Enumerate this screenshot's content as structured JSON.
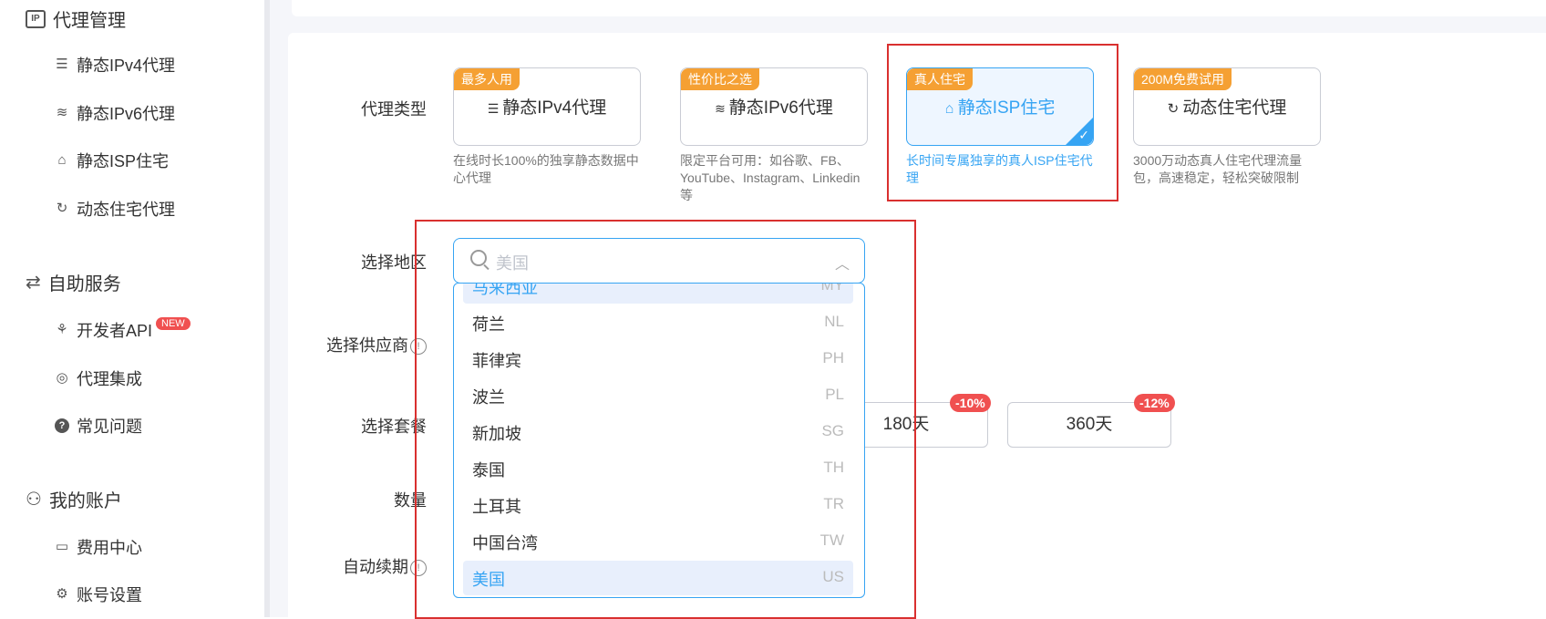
{
  "sidebar": {
    "groups": [
      {
        "label": "代理管理",
        "icon": "ip-icon"
      },
      {
        "label": "自助服务",
        "icon": "self-service-icon"
      },
      {
        "label": "我的账户",
        "icon": "user-icon"
      }
    ],
    "proxy_items": [
      {
        "label": "静态IPv4代理",
        "icon": "server-icon"
      },
      {
        "label": "静态IPv6代理",
        "icon": "layers-icon"
      },
      {
        "label": "静态ISP住宅",
        "icon": "home-icon"
      },
      {
        "label": "动态住宅代理",
        "icon": "rotate-icon"
      }
    ],
    "service_items": [
      {
        "label": "开发者API",
        "icon": "api-icon",
        "badge": "NEW"
      },
      {
        "label": "代理集成",
        "icon": "fingerprint-icon"
      },
      {
        "label": "常见问题",
        "icon": "help-icon"
      }
    ],
    "account_items": [
      {
        "label": "费用中心",
        "icon": "card-icon"
      },
      {
        "label": "账号设置",
        "icon": "gear-icon"
      }
    ]
  },
  "form": {
    "proxy_type_label": "代理类型",
    "region_label": "选择地区",
    "supplier_label": "选择供应商",
    "package_label": "选择套餐",
    "quantity_label": "数量",
    "auto_renew_label": "自动续期"
  },
  "proxy_types": [
    {
      "tag": "最多人用",
      "name": "静态IPv4代理",
      "desc": "在线时长100%的独享静态数据中心代理",
      "selected": false
    },
    {
      "tag": "性价比之选",
      "name": "静态IPv6代理",
      "desc": "限定平台可用：如谷歌、FB、YouTube、Instagram、Linkedin等",
      "selected": false
    },
    {
      "tag": "真人住宅",
      "name": "静态ISP住宅",
      "desc": "长时间专属独享的真人ISP住宅代理",
      "selected": true
    },
    {
      "tag": "200M免费试用",
      "name": "动态住宅代理",
      "desc": "3000万动态真人住宅代理流量包，高速稳定，轻松突破限制",
      "selected": false
    }
  ],
  "region_search": {
    "placeholder": "美国"
  },
  "region_options": [
    {
      "name": "马来西亚",
      "code": "MY"
    },
    {
      "name": "荷兰",
      "code": "NL"
    },
    {
      "name": "菲律宾",
      "code": "PH"
    },
    {
      "name": "波兰",
      "code": "PL"
    },
    {
      "name": "新加坡",
      "code": "SG"
    },
    {
      "name": "泰国",
      "code": "TH"
    },
    {
      "name": "土耳其",
      "code": "TR"
    },
    {
      "name": "中国台湾",
      "code": "TW"
    },
    {
      "name": "美国",
      "code": "US"
    }
  ],
  "packages": [
    {
      "label": "180天",
      "discount": "-10%"
    },
    {
      "label": "360天",
      "discount": "-12%"
    }
  ],
  "colors": {
    "accent": "#36a4f3",
    "tag": "#f5a033",
    "discount": "#f05050",
    "highlight_box": "#d9302f"
  }
}
